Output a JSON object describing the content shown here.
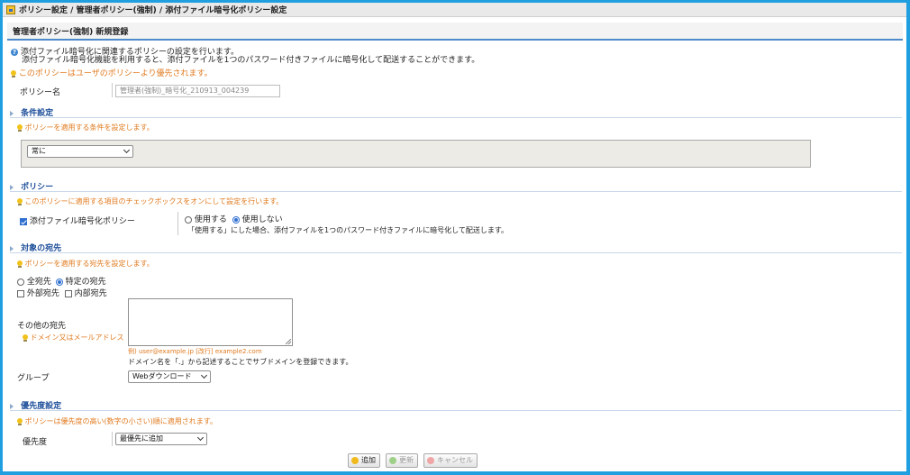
{
  "breadcrumb": "ポリシー設定 / 管理者ポリシー(強制) / 添付ファイル暗号化ポリシー設定",
  "header_title": "管理者ポリシー(強制) 新規登録",
  "intro": {
    "line1": "添付ファイル暗号化に関連するポリシーの設定を行います。",
    "line2": "添付ファイル暗号化機能を利用すると、添付ファイルを1つのパスワード付きファイルに暗号化して配送することができます。"
  },
  "priority_note": "このポリシーはユーザのポリシーより優先されます。",
  "policy_name": {
    "label": "ポリシー名",
    "value": "管理者(強制)_暗号化_210913_004239"
  },
  "condition": {
    "title": "条件設定",
    "hint": "ポリシーを適用する条件を設定します。",
    "selected": "常に"
  },
  "policy": {
    "title": "ポリシー",
    "hint": "このポリシーに適用する項目のチェックボックスをオンにして設定を行います。",
    "item_label": "添付ファイル暗号化ポリシー",
    "opt_use": "使用する",
    "opt_nouse": "使用しない",
    "note": "「使用する」にした場合、添付ファイルを1つのパスワード付きファイルに暗号化して配送します。"
  },
  "recipients": {
    "title": "対象の宛先",
    "hint": "ポリシーを適用する宛先を設定します。",
    "all": "全宛先",
    "specific": "特定の宛先",
    "external": "外部宛先",
    "internal": "内部宛先",
    "other_label": "その他の宛先",
    "domain_hint": "ドメイン又はメールアドレス",
    "example": "例) user@example.jp [改行] example2.com",
    "subdomain_note": "ドメイン名を「.」から記述することでサブドメインを登録できます。",
    "group_label": "グループ",
    "group_selected": "Webダウンロード"
  },
  "priority": {
    "title": "優先度設定",
    "hint": "ポリシーは優先度の高い(数字の小さい)順に適用されます。",
    "label": "優先度",
    "selected": "最優先に追加"
  },
  "buttons": {
    "add": "追加",
    "update": "更新",
    "cancel": "キャンセル"
  },
  "colors": {
    "frame": "#1f9fe0",
    "accent": "#4c8ac9",
    "hint_orange": "#e07a1f",
    "section_blue": "#1d4e9a"
  }
}
